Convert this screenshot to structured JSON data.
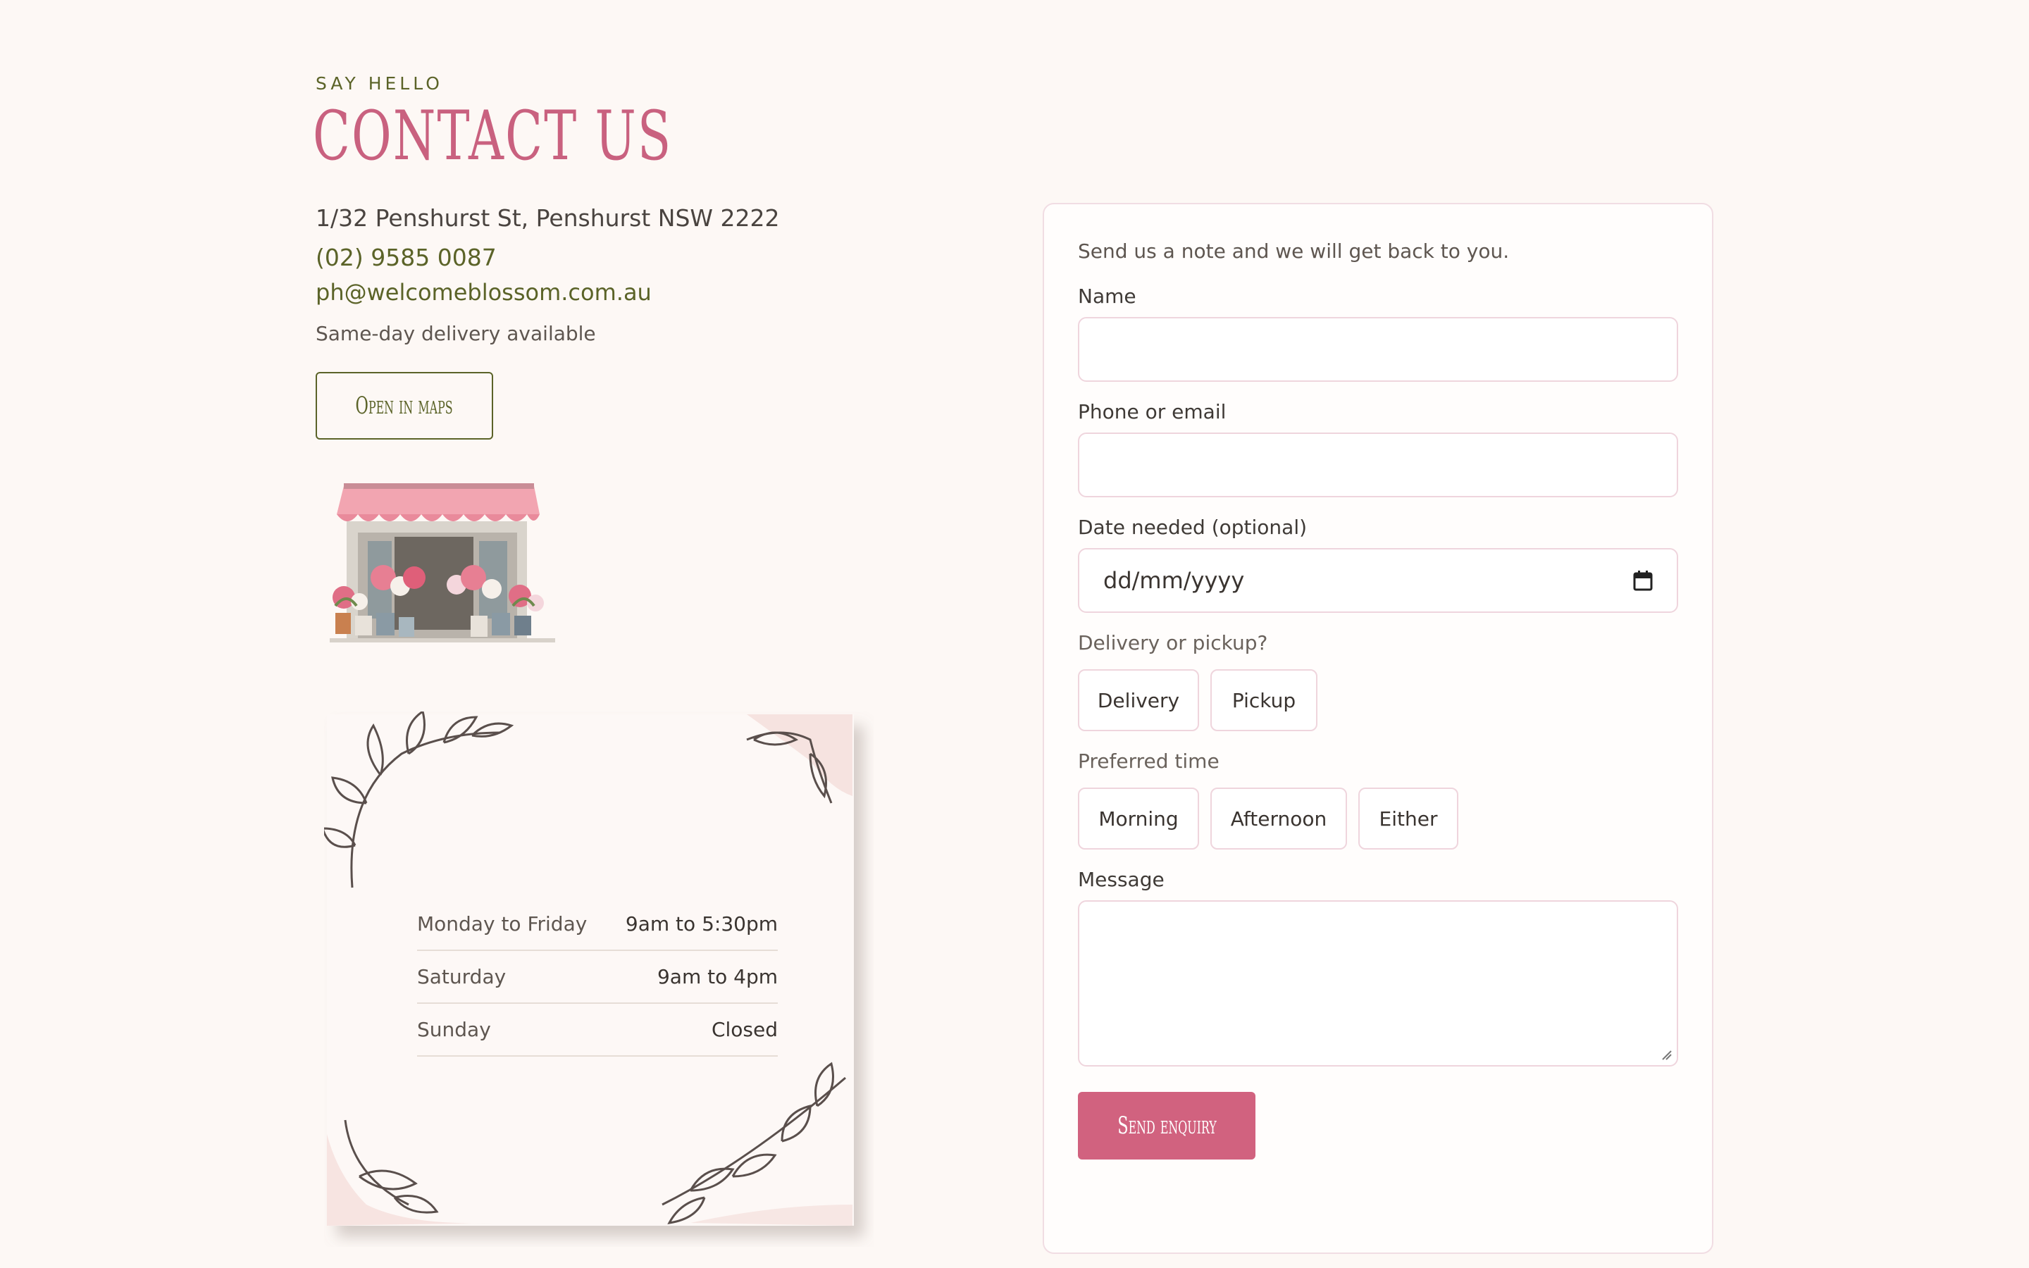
{
  "header": {
    "eyebrow": "SAY HELLO",
    "title": "CONTACT US"
  },
  "contact": {
    "address": "1/32 Penshurst St, Penshurst NSW 2222",
    "phone": "(02) 9585 0087",
    "email": "ph@welcomeblossom.com.au",
    "delivery_note": "Same-day delivery available",
    "maps_button": "Open in maps"
  },
  "hours": [
    {
      "day": "Monday to Friday",
      "time": "9am to 5:30pm"
    },
    {
      "day": "Saturday",
      "time": "9am to 4pm"
    },
    {
      "day": "Sunday",
      "time": "Closed"
    }
  ],
  "form": {
    "intro": "Send us a note and we will get back to you.",
    "name_label": "Name",
    "name_value": "",
    "contact_label": "Phone or email",
    "contact_value": "",
    "date_label": "Date needed (optional)",
    "date_placeholder": "dd/mm/yyyy",
    "delivery_label": "Delivery or pickup?",
    "delivery_options": [
      "Delivery",
      "Pickup"
    ],
    "time_label": "Preferred time",
    "time_options": [
      "Morning",
      "Afternoon",
      "Either"
    ],
    "message_label": "Message",
    "message_value": "",
    "submit_label": "Send enquiry"
  },
  "icons": {
    "calendar": "calendar-icon",
    "resize": "resize-grip-icon",
    "shop": "flower-shop-illustration",
    "leaves": "leaf-branch-decoration"
  },
  "colors": {
    "background": "#fdf8f5",
    "accent_pink": "#c9617f",
    "button_pink": "#d1627f",
    "olive": "#5b6328",
    "field_border": "#efd5dd"
  }
}
